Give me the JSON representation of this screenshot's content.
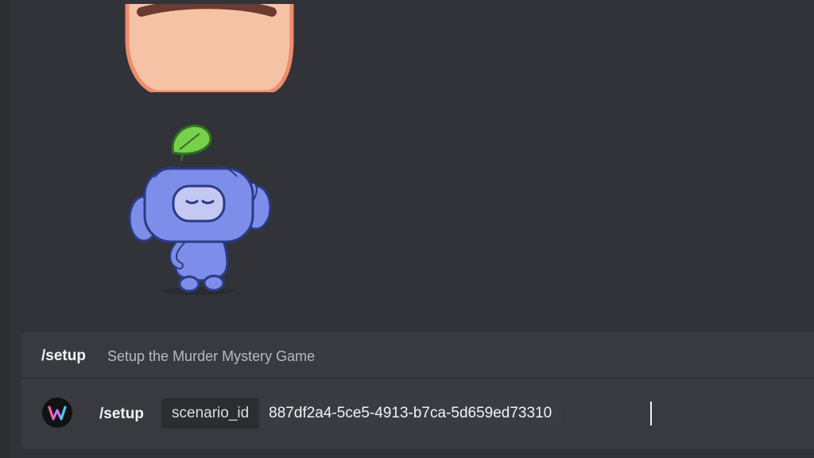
{
  "chat": {
    "stickers": [
      {
        "icon": "character-face-sticker"
      },
      {
        "icon": "wumpus-wave-sticker"
      }
    ]
  },
  "command_panel": {
    "command": "/setup",
    "description": "Setup the Murder Mystery Game",
    "input": {
      "command": "/setup",
      "app_icon": "app-logo-icon",
      "option_name": "scenario_id",
      "option_value": "887df2a4-5ce5-4913-b7ca-5d659ed73310"
    }
  },
  "colors": {
    "background": "#313338",
    "panel": "#383a40",
    "text": "#f2f3f5",
    "muted": "#b5bac1",
    "wumpus": "#7c8ee9"
  }
}
